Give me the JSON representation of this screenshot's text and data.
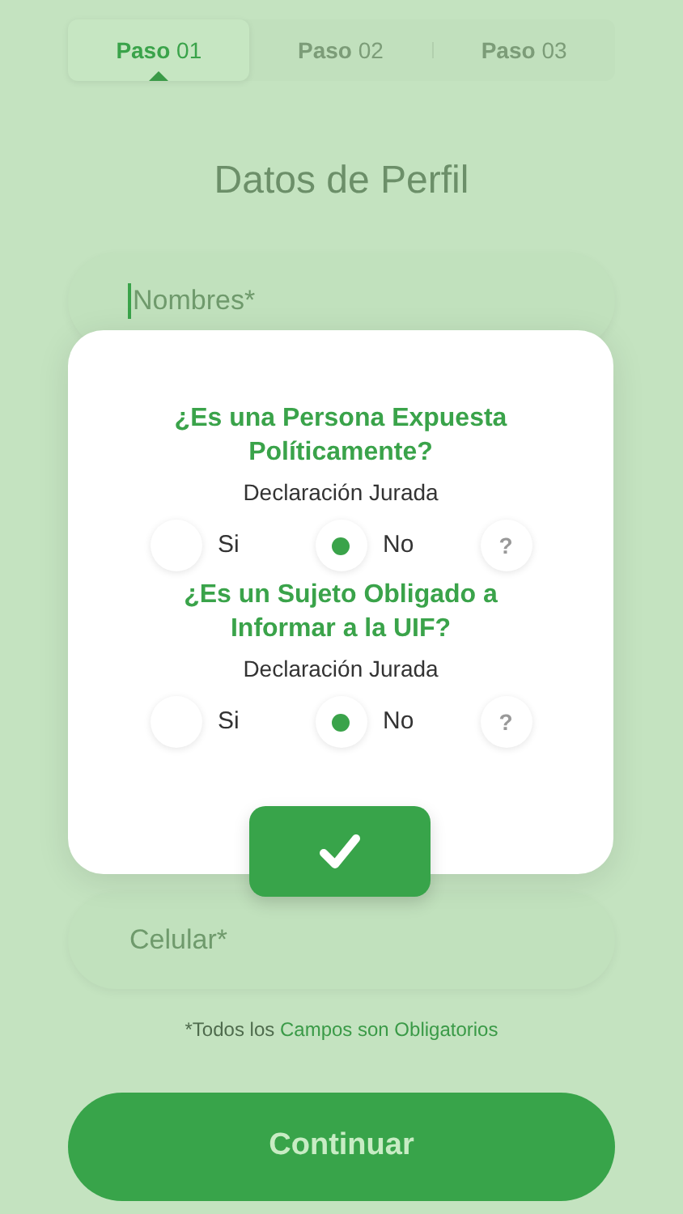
{
  "steps": [
    {
      "label": "**Paso** 01",
      "selected": true
    },
    {
      "label": "**Paso** 02",
      "selected": false
    },
    {
      "label": "**Paso** 03",
      "selected": false
    }
  ],
  "title": "Datos de Perfil",
  "fields": [
    {
      "placeholder": "Nombres*",
      "focused": true
    },
    {
      "placeholder": "Celular*",
      "focused": false
    }
  ],
  "dialog": {
    "questions": [
      {
        "title": "¿Es una Persona Expuesta Políticamente?",
        "subtitle": "Declaración Jurada",
        "options": [
          {
            "kind": "radio",
            "label": "Si",
            "selected": false
          },
          {
            "kind": "radio",
            "label": "No",
            "selected": true
          },
          {
            "kind": "help",
            "label": "?"
          }
        ]
      },
      {
        "title": "¿Es un Sujeto Obligado a Informar a la UIF?",
        "subtitle": "Declaración Jurada",
        "options": [
          {
            "kind": "radio",
            "label": "Si",
            "selected": false
          },
          {
            "kind": "radio",
            "label": "No",
            "selected": true
          },
          {
            "kind": "help",
            "label": "?"
          }
        ]
      }
    ]
  },
  "note": {
    "prefix": "*Todos los",
    "highlight": "Campos son Obligatorios"
  },
  "continue_button": "Continuar"
}
